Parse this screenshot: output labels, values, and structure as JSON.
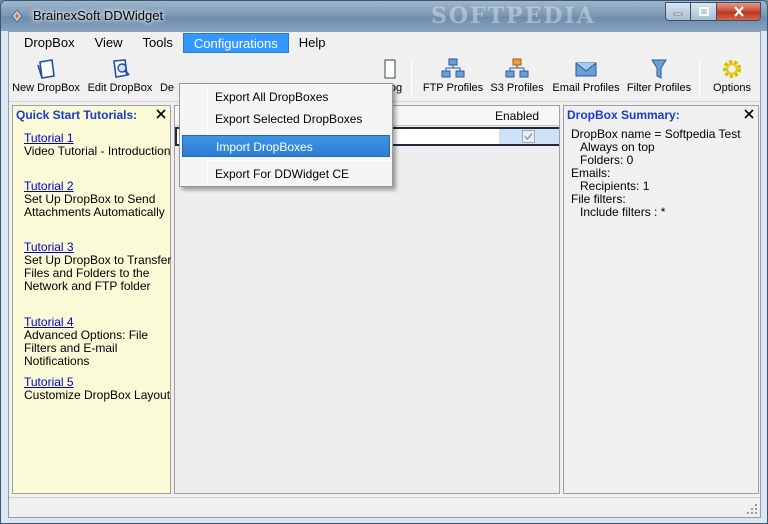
{
  "window": {
    "title": "BrainexSoft DDWidget",
    "watermark": "SOFTPEDIA"
  },
  "menubar": {
    "items": [
      "DropBox",
      "View",
      "Tools",
      "Configurations",
      "Help"
    ],
    "active": "Configurations"
  },
  "toolbar": {
    "buttons": [
      {
        "label": "New DropBox",
        "icon": "new-dropbox-icon"
      },
      {
        "label": "Edit DropBox",
        "icon": "edit-dropbox-icon"
      },
      {
        "label": "De",
        "icon": "delete-dropbox-icon"
      },
      {
        "label": "Log",
        "icon": "log-icon"
      },
      {
        "label": "FTP Profiles",
        "icon": "ftp-profiles-icon"
      },
      {
        "label": "S3 Profiles",
        "icon": "s3-profiles-icon"
      },
      {
        "label": "Email Profiles",
        "icon": "email-profiles-icon"
      },
      {
        "label": "Filter Profiles",
        "icon": "filter-profiles-icon"
      },
      {
        "label": "Options",
        "icon": "options-gear-icon"
      }
    ]
  },
  "configurations_menu": {
    "items": [
      "Export All DropBoxes",
      "Export Selected DropBoxes",
      "Import DropBoxes",
      "Export For DDWidget CE"
    ],
    "highlighted": "Import DropBoxes"
  },
  "tutorials": {
    "title": "Quick Start Tutorials:",
    "items": [
      {
        "link": "Tutorial 1",
        "desc": "Video Tutorial - Introduction"
      },
      {
        "link": "Tutorial 2",
        "desc": "Set Up DropBox to Send Attachments Automatically"
      },
      {
        "link": "Tutorial 3",
        "desc": "Set Up DropBox to Transfer Files and Folders to the Network and FTP folder"
      },
      {
        "link": "Tutorial 4",
        "desc": "Advanced Options: File Filters and E-mail Notifications"
      },
      {
        "link": "Tutorial 5",
        "desc": "Customize DropBox Layout"
      }
    ]
  },
  "grid": {
    "columns": [
      "Enabled"
    ],
    "rows": [
      {
        "name": "",
        "enabled": true
      }
    ]
  },
  "summary": {
    "title": "DropBox Summary:",
    "lines": [
      {
        "text": "DropBox name = Softpedia Test",
        "indent": false
      },
      {
        "text": "Always on top",
        "indent": true
      },
      {
        "text": "Folders: 0",
        "indent": true
      },
      {
        "text": "Emails:",
        "indent": false
      },
      {
        "text": "Recipients: 1",
        "indent": true
      },
      {
        "text": "File filters:",
        "indent": false
      },
      {
        "text": "Include filters : *",
        "indent": true
      }
    ]
  },
  "colors": {
    "menu_highlight": "#3399ff",
    "tutorial_panel_bg": "#fbfad6",
    "panel_title": "#1a3cc8"
  }
}
